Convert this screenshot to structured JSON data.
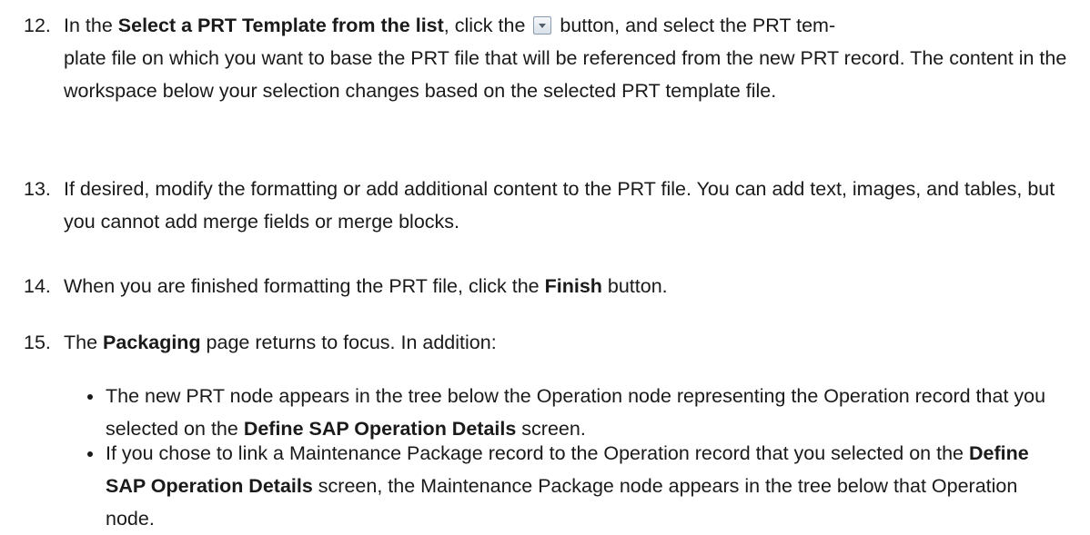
{
  "steps": [
    {
      "number": "12.",
      "segments": [
        {
          "text": "In the ",
          "bold": false
        },
        {
          "text": "Select a PRT Template from the list",
          "bold": true
        },
        {
          "text": ", click the ",
          "bold": false
        },
        {
          "text": " button, and select the PRT tem-",
          "bold": false
        }
      ],
      "continuation": "plate file on which you want to base the PRT file that will be referenced from the new PRT record. The content in the workspace below your selection changes based on the selected PRT template file.",
      "icon": "dropdown-button-icon"
    },
    {
      "number": "13.",
      "text": "If desired, modify the formatting or add additional content to the PRT file. You can add text, images, and tables, but you cannot add merge fields or merge blocks."
    },
    {
      "number": "14.",
      "before": "When you are finished formatting the PRT file, click the ",
      "bold": "Finish",
      "after": " button."
    },
    {
      "number": "15.",
      "before": "The ",
      "bold": "Packaging",
      "after": " page returns to focus. In addition:"
    }
  ],
  "bullets": [
    {
      "before": "The new PRT node appears in the tree below the Operation node representing the Operation record that you selected on the ",
      "bold": "Define SAP Operation Details",
      "after": " screen."
    },
    {
      "before": "If you chose to link a Maintenance Package record to the Operation record that you selected on the ",
      "bold": "Define SAP Operation Details",
      "after": " screen, the Maintenance Package node appears in the tree below that Operation node."
    }
  ]
}
